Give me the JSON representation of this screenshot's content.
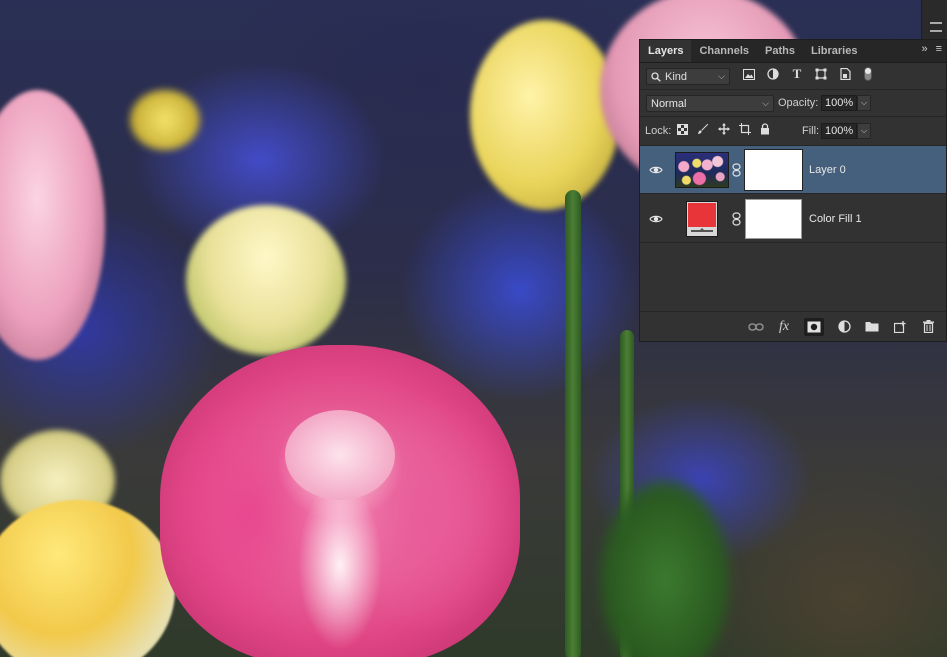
{
  "panel": {
    "tabs": [
      {
        "label": "Layers",
        "active": true
      },
      {
        "label": "Channels",
        "active": false
      },
      {
        "label": "Paths",
        "active": false
      },
      {
        "label": "Libraries",
        "active": false
      }
    ],
    "tab_menu_collapse": "»",
    "tab_menu_options": "≡",
    "filter": {
      "kind_label": "Kind",
      "icons": [
        "image-filter-icon",
        "adjustment-filter-icon",
        "type-filter-icon",
        "shape-filter-icon",
        "smart-object-filter-icon"
      ]
    },
    "blend_mode": "Normal",
    "opacity_label": "Opacity:",
    "opacity_value": "100%",
    "lock_label": "Lock:",
    "fill_label": "Fill:",
    "fill_value": "100%",
    "layers": [
      {
        "name": "Layer 0",
        "selected": true,
        "visible": true,
        "fill_color": ""
      },
      {
        "name": "Color Fill 1",
        "selected": false,
        "visible": true,
        "fill_color": "#e8353a"
      }
    ],
    "bottom_icons": [
      "link-layers-icon",
      "fx-icon",
      "add-mask-icon",
      "adjustment-layer-icon",
      "group-folder-icon",
      "new-layer-icon",
      "trash-icon"
    ],
    "fx_label": "fx"
  },
  "colors": {
    "panel_bg": "#323232",
    "selected_row": "#44607d",
    "fill_swatch": "#e8353a"
  }
}
